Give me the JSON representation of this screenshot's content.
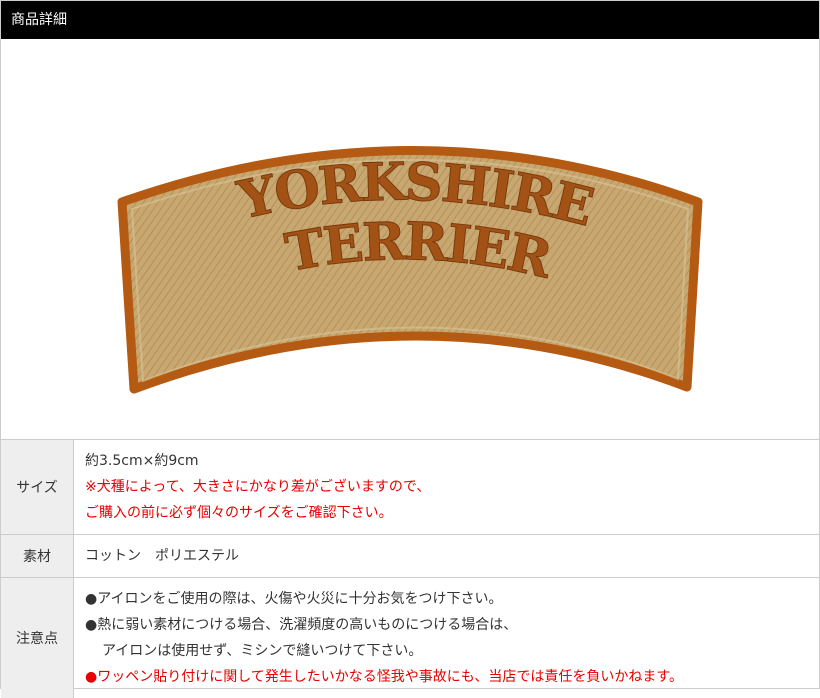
{
  "header": {
    "title": "商品詳細"
  },
  "product_image": {
    "alt": "YORKSHIRE TERRIER",
    "line1": "YORKSHIRE",
    "line2": "TERRIER",
    "colors": {
      "fill": "#c5a46a",
      "border": "#b45a12",
      "text": "#9c4a10"
    }
  },
  "specs": {
    "size": {
      "label": "サイズ",
      "value": "約3.5cm×約9cm",
      "note1": "※犬種によって、大きさにかなり差がございますので、",
      "note2": "ご購入の前に必ず個々のサイズをご確認下さい。"
    },
    "material": {
      "label": "素材",
      "value": "コットン　ポリエステル"
    },
    "notes": {
      "label": "注意点",
      "line1": "●アイロンをご使用の際は、火傷や火災に十分お気をつけ下さい。",
      "line2": "●熱に弱い素材につける場合、洗濯頻度の高いものにつける場合は、",
      "line3": "アイロンは使用せず、ミシンで縫いつけて下さい。",
      "line4": "●ワッペン貼り付けに関して発生したいかなる怪我や事故にも、当店では責任を負いかねます。"
    }
  },
  "colors": {
    "header_bg": "#000000",
    "label_bg": "#eeeeee",
    "warning": "#e60000"
  }
}
